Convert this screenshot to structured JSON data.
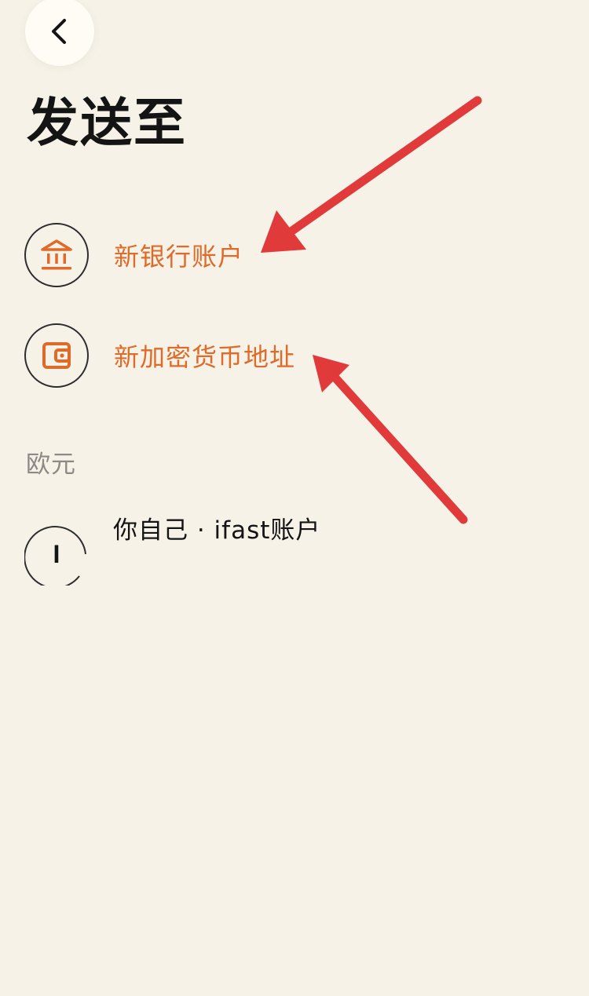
{
  "header": {
    "back_icon": "chevron-left-icon",
    "title": "发送至"
  },
  "options": [
    {
      "label": "新银行账户",
      "icon": "bank-icon"
    },
    {
      "label": "新加密货币地址",
      "icon": "wallet-icon"
    }
  ],
  "sections": [
    {
      "heading": "欧元",
      "accounts": [
        {
          "title": "你自己 · ifast账户",
          "avatar_initial": "I"
        }
      ]
    }
  ],
  "colors": {
    "background": "#F6F2E8",
    "accent_orange": "#E06A27",
    "title_text": "#141414",
    "secondary_text": "#8C8A86",
    "annotation_red": "#E13A3A"
  }
}
